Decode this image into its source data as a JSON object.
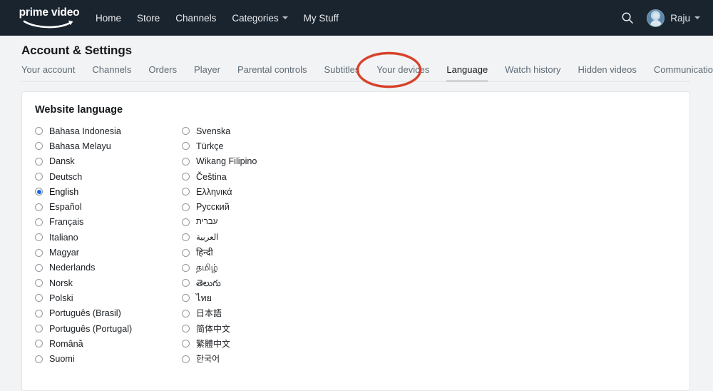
{
  "colors": {
    "nav_background": "#1a242f",
    "page_background": "#f1f3f4",
    "card_background": "#ffffff",
    "accent_radio_selected": "#1768e5",
    "annotation_red": "#d8412a",
    "text_primary": "#16191c",
    "text_muted": "#5f6b76"
  },
  "topnav": {
    "logo": {
      "text": "prime video",
      "icon": "amazon-smile-icon"
    },
    "links": [
      {
        "label": "Home",
        "has_caret": false
      },
      {
        "label": "Store",
        "has_caret": false
      },
      {
        "label": "Channels",
        "has_caret": false
      },
      {
        "label": "Categories",
        "has_caret": true
      },
      {
        "label": "My Stuff",
        "has_caret": false
      }
    ],
    "search_icon": "search-icon",
    "avatar_icon": "user-avatar-icon",
    "username": "Raju",
    "user_caret": "chevron-down-icon"
  },
  "page": {
    "title": "Account & Settings"
  },
  "tabs": {
    "active": "Language",
    "items": [
      {
        "label": "Your account"
      },
      {
        "label": "Channels"
      },
      {
        "label": "Orders"
      },
      {
        "label": "Player"
      },
      {
        "label": "Parental controls"
      },
      {
        "label": "Subtitles"
      },
      {
        "label": "Your devices"
      },
      {
        "label": "Language"
      },
      {
        "label": "Watch history"
      },
      {
        "label": "Hidden videos"
      },
      {
        "label": "Communications"
      }
    ]
  },
  "annotation": {
    "shape": "ellipse",
    "target": "Language",
    "color": "#d8412a"
  },
  "card": {
    "title": "Website language",
    "selected_language": "English",
    "columns": [
      {
        "languages": [
          "Bahasa Indonesia",
          "Bahasa Melayu",
          "Dansk",
          "Deutsch",
          "English",
          "Español",
          "Français",
          "Italiano",
          "Magyar",
          "Nederlands",
          "Norsk",
          "Polski",
          "Português (Brasil)",
          "Português (Portugal)",
          "Română",
          "Suomi"
        ]
      },
      {
        "languages": [
          "Svenska",
          "Türkçe",
          "Wikang Filipino",
          "Čeština",
          "Ελληνικά",
          "Русский",
          "עברית",
          "العربية",
          "हिन्दी",
          "தமிழ்",
          "తెలుగు",
          "ไทย",
          "日本語",
          "简体中文",
          "繁體中文",
          "한국어"
        ]
      }
    ]
  }
}
